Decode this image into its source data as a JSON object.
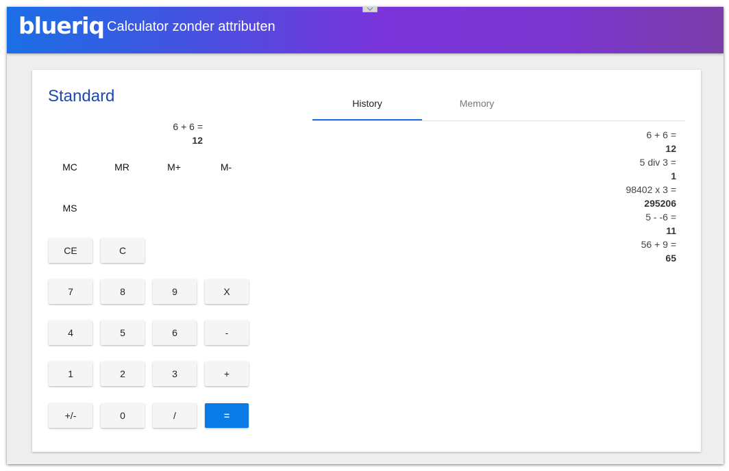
{
  "header": {
    "logo_text": "blueriq",
    "title": "Calculator zonder attributen"
  },
  "calculator": {
    "title": "Standard",
    "display": {
      "expression": "6 + 6 =",
      "result": "12"
    },
    "memory_buttons": [
      "MC",
      "MR",
      "M+",
      "M-",
      "MS"
    ],
    "keys": {
      "ce": "CE",
      "c": "C",
      "seven": "7",
      "eight": "8",
      "nine": "9",
      "multiply": "X",
      "four": "4",
      "five": "5",
      "six": "6",
      "minus": "-",
      "one": "1",
      "two": "2",
      "three": "3",
      "plus": "+",
      "negate": "+/-",
      "zero": "0",
      "divide": "/",
      "equals": "="
    }
  },
  "tabs": {
    "history": "History",
    "memory": "Memory"
  },
  "history": [
    {
      "expression": "6 + 6 =",
      "result": "12"
    },
    {
      "expression": "5 div 3 =",
      "result": "1"
    },
    {
      "expression": "98402 x 3 =",
      "result": "295206"
    },
    {
      "expression": "5 - -6 =",
      "result": "11"
    },
    {
      "expression": "56 + 9 =",
      "result": "65"
    }
  ],
  "colors": {
    "accent": "#0a7ae6",
    "title": "#1e48b0",
    "header_gradient_start": "#1a6fe6",
    "header_gradient_end": "#7a3ea8"
  }
}
